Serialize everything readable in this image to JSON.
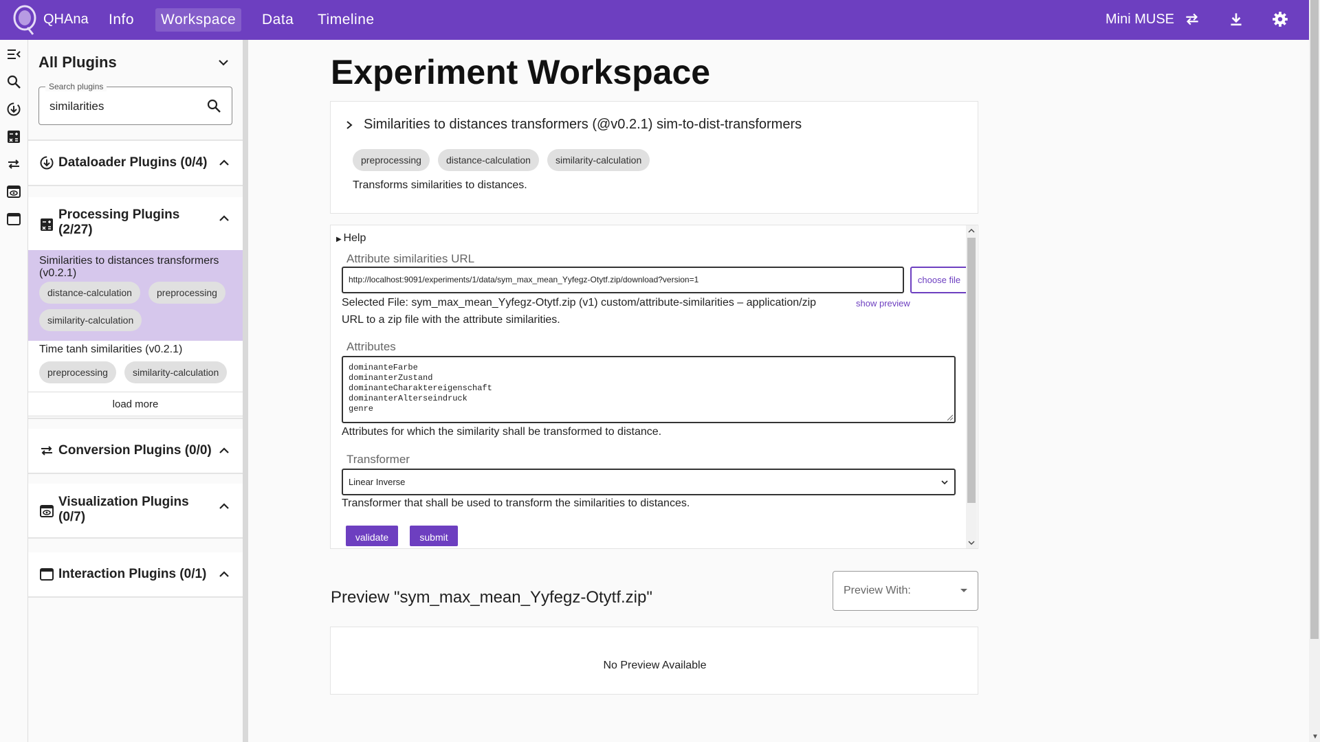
{
  "app": {
    "brand": "QHAna"
  },
  "nav": {
    "tabs": [
      {
        "label": "Info"
      },
      {
        "label": "Workspace"
      },
      {
        "label": "Data"
      },
      {
        "label": "Timeline"
      }
    ]
  },
  "toolbar": {
    "workspace_name": "Mini MUSE",
    "accent_color": "#6d3fc0"
  },
  "sidebar": {
    "title": "All Plugins",
    "search": {
      "legend": "Search plugins",
      "value": "similarities"
    },
    "sections": {
      "dataloader": {
        "label": "Dataloader Plugins (0/4)"
      },
      "processing": {
        "label": "Processing Plugins (2/27)"
      },
      "conversion": {
        "label": "Conversion Plugins (0/0)"
      },
      "visualization": {
        "label": "Visualization Plugins (0/7)"
      },
      "interaction": {
        "label": "Interaction Plugins (0/1)"
      }
    },
    "plugins": [
      {
        "name": "Similarities to distances transformers (v0.2.1)",
        "tags": [
          "distance-calculation",
          "preprocessing",
          "similarity-calculation"
        ]
      },
      {
        "name": "Time tanh similarities (v0.2.1)",
        "tags": [
          "preprocessing",
          "similarity-calculation"
        ]
      }
    ],
    "load_more": "load more"
  },
  "main": {
    "title": "Experiment Workspace",
    "plugin": {
      "title": "Similarities to distances transformers (@v0.2.1) sim-to-dist-transformers",
      "tags": [
        "preprocessing",
        "distance-calculation",
        "similarity-calculation"
      ],
      "description": "Transforms similarities to distances."
    },
    "form": {
      "help": "Help",
      "url_label": "Attribute similarities URL",
      "url_value": "http://localhost:9091/experiments/1/data/sym_max_mean_Yyfegz-Otytf.zip/download?version=1",
      "choose_file": "choose file",
      "selected_file": "Selected File: sym_max_mean_Yyfegz-Otytf.zip (v1) custom/attribute-similarities – application/zip",
      "show_preview": "show preview",
      "url_help": "URL to a zip file with the attribute similarities.",
      "attributes_label": "Attributes",
      "attributes_lines": [
        "dominanteFarbe",
        "dominanterZustand",
        "dominanteCharaktereigenschaft",
        "dominanterAlterseindruck",
        "genre"
      ],
      "attributes_help": "Attributes for which the similarity shall be transformed to distance.",
      "transformer_label": "Transformer",
      "transformer_value": "Linear Inverse",
      "transformer_help": "Transformer that shall be used to transform the similarities to distances.",
      "validate": "validate",
      "submit": "submit"
    },
    "preview": {
      "title": "Preview \"sym_max_mean_Yyfegz-Otytf.zip\"",
      "select_label": "Preview With:",
      "empty": "No Preview Available"
    }
  }
}
